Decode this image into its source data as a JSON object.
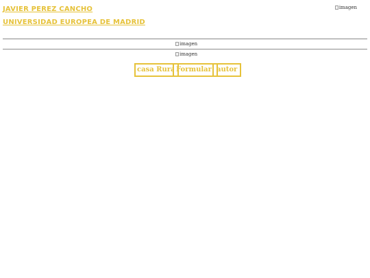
{
  "header": {
    "author_name": "JAVIER PEREZ CANCHO",
    "university": "UNIVERSIDAD EUROPEA DE MADRID",
    "logo_alt": "imagen"
  },
  "banner": {
    "image1_alt": "imagen",
    "image2_alt": "imagen"
  },
  "menu": {
    "items": [
      {
        "label": "casa Rural"
      },
      {
        "label": "Formulario"
      },
      {
        "label": "autor"
      }
    ]
  },
  "colors": {
    "link": "#e6c23a",
    "background": "#ffffff"
  }
}
